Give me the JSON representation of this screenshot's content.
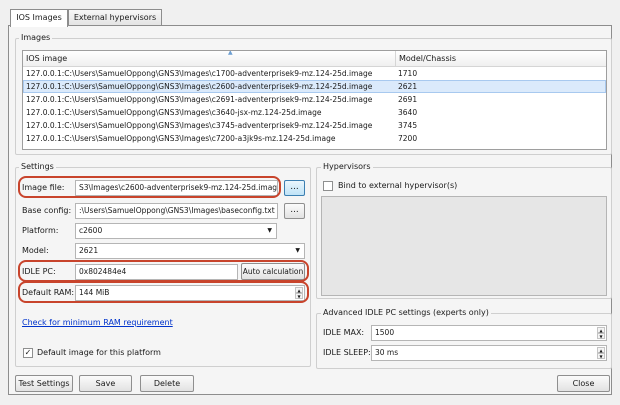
{
  "tabs": [
    {
      "label": "IOS Images"
    },
    {
      "label": "External hypervisors"
    }
  ],
  "images_group": {
    "title": "Images",
    "columns": [
      "IOS image",
      "Model/Chassis"
    ],
    "rows": [
      {
        "image": "127.0.0.1:C:\\Users\\SamuelOppong\\GNS3\\Images\\c1700-adventerprisek9-mz.124-25d.image",
        "model": "1710"
      },
      {
        "image": "127.0.0.1:C:\\Users\\SamuelOppong\\GNS3\\Images\\c2600-adventerprisek9-mz.124-25d.image",
        "model": "2621"
      },
      {
        "image": "127.0.0.1:C:\\Users\\SamuelOppong\\GNS3\\Images\\c2691-adventerprisek9-mz.124-25d.image",
        "model": "2691"
      },
      {
        "image": "127.0.0.1:C:\\Users\\SamuelOppong\\GNS3\\Images\\c3640-jsx-mz.124-25d.image",
        "model": "3640"
      },
      {
        "image": "127.0.0.1:C:\\Users\\SamuelOppong\\GNS3\\Images\\c3745-adventerprisek9-mz.124-25d.image",
        "model": "3745"
      },
      {
        "image": "127.0.0.1:C:\\Users\\SamuelOppong\\GNS3\\Images\\c7200-a3jk9s-mz.124-25d.image",
        "model": "7200"
      }
    ],
    "selected_row": 1
  },
  "settings": {
    "title": "Settings",
    "image_file": {
      "label": "Image file:",
      "value": "S3\\Images\\c2600-adventerprisek9-mz.124-25d.image"
    },
    "base_config": {
      "label": "Base config:",
      "value": ":\\Users\\SamuelOppong\\GNS3\\Images\\baseconfig.txt"
    },
    "platform": {
      "label": "Platform:",
      "value": "c2600"
    },
    "model": {
      "label": "Model:",
      "value": "2621"
    },
    "idle_pc": {
      "label": "IDLE PC:",
      "value": "0x802484e4",
      "button": "Auto calculation"
    },
    "default_ram": {
      "label": "Default RAM:",
      "value": "144 MiB"
    },
    "browse_label": "...",
    "ram_link": "Check for minimum RAM requirement",
    "default_image": {
      "label": "Default image for this platform",
      "checked": true
    }
  },
  "hypervisors": {
    "title": "Hypervisors",
    "bind_label": "Bind to external hypervisor(s)",
    "bind_checked": false
  },
  "advanced": {
    "title": "Advanced IDLE PC settings (experts only)",
    "idle_max": {
      "label": "IDLE MAX:",
      "value": "1500"
    },
    "idle_sleep": {
      "label": "IDLE SLEEP:",
      "value": "30 ms"
    }
  },
  "buttons": {
    "test_settings": "Test Settings",
    "save": "Save",
    "delete": "Delete",
    "close": "Close"
  },
  "colors": {
    "highlight": "#c8442c",
    "selection": "#dbeafb",
    "link": "#0033cc"
  }
}
